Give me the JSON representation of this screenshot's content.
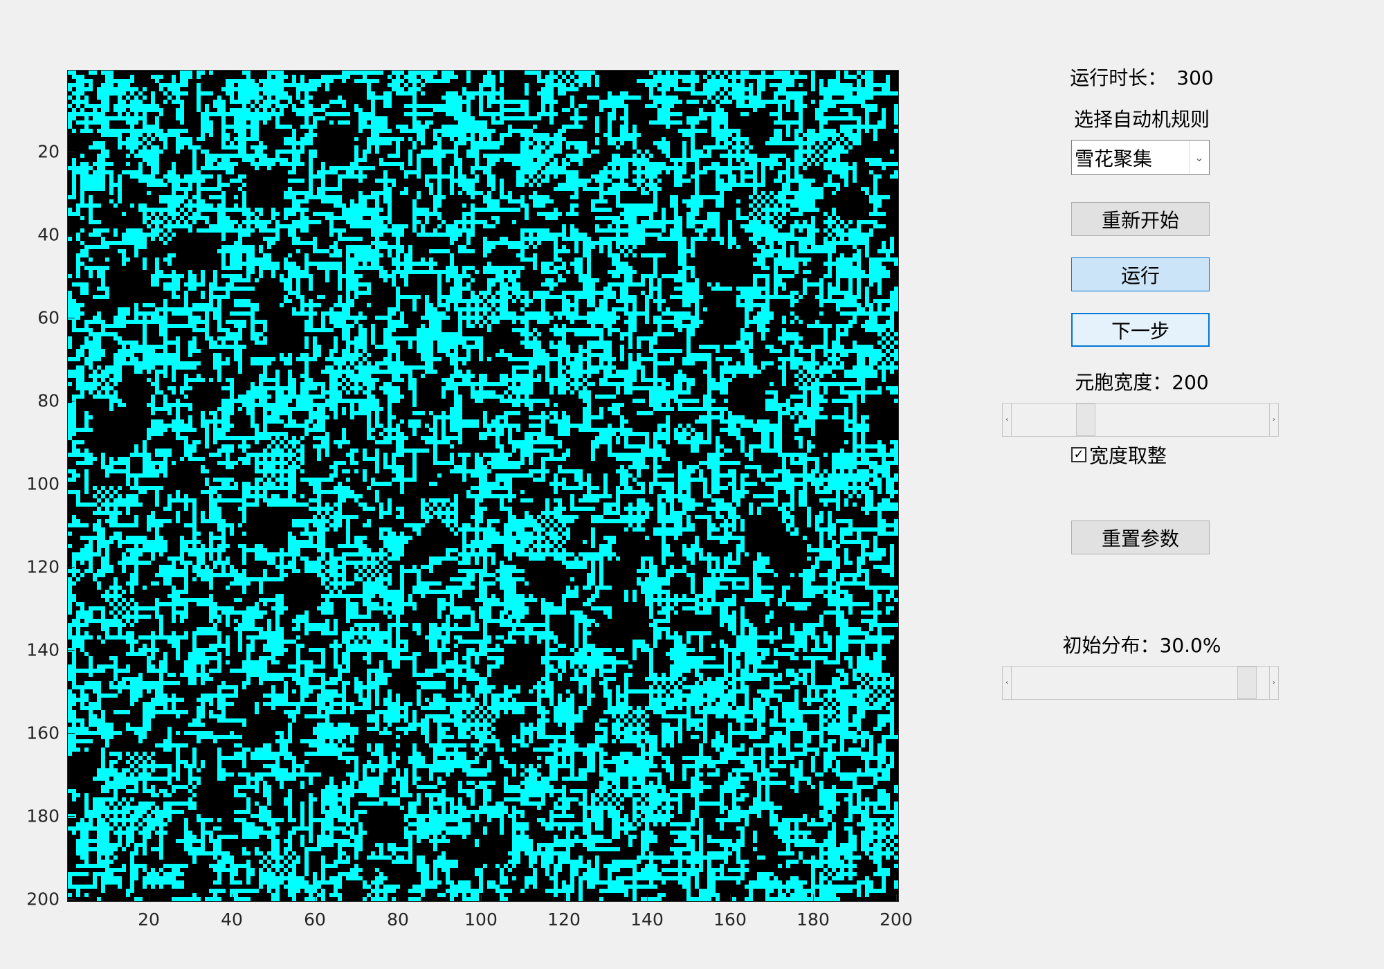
{
  "controls": {
    "run_time_label": "运行时长：",
    "run_time_value": "300",
    "rule_label": "选择自动机规则",
    "rule_select": {
      "selected": "雪花聚集",
      "arrow": "chevron-down-icon"
    },
    "restart_button": "重新开始",
    "run_button": "运行",
    "next_step_button": "下一步",
    "cell_width_label": "元胞宽度：",
    "cell_width_value": "200",
    "cell_width_slider_fraction": 0.27,
    "round_width_checkbox": {
      "label": "宽度取整",
      "checked": true,
      "check_glyph": "✓"
    },
    "reset_params_button": "重置参数",
    "initial_dist_label": "初始分布：",
    "initial_dist_value": "30.0%",
    "initial_dist_slider_fraction": 0.95,
    "slider_left_arrow": "‹",
    "slider_right_arrow": "›"
  },
  "plot": {
    "grid_size": 200,
    "cell_color": "#00ffff",
    "background_color": "#000000",
    "y_ticks": [
      "20",
      "40",
      "60",
      "80",
      "100",
      "120",
      "140",
      "160",
      "180",
      "200"
    ],
    "x_ticks": [
      "20",
      "40",
      "60",
      "80",
      "100",
      "120",
      "140",
      "160",
      "180",
      "200"
    ],
    "y_range": [
      0.5,
      200.5
    ],
    "x_range": [
      0.5,
      200.5
    ]
  },
  "colors": {
    "window_bg": "#f0f0f0",
    "button_active_bg": "#cce4f7",
    "button_active_border": "#0078d7"
  }
}
